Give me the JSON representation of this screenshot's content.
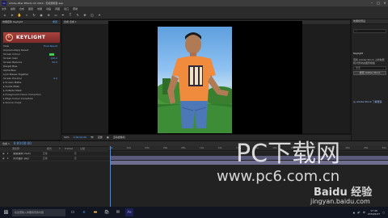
{
  "window": {
    "title": "Adobe After Effects CC 2019 - 无标题项目.aep",
    "app_icon_text": "Ae"
  },
  "menu": [
    "文件",
    "编辑",
    "合成",
    "图层",
    "效果",
    "动画",
    "视图",
    "窗口",
    "帮助"
  ],
  "effect_controls": {
    "tab_label": "效果控件 Keylight",
    "reset_label": "重置",
    "keylight_name": "KEYLIGHT",
    "rows": [
      {
        "label": "View",
        "value": "Final Result"
      },
      {
        "label": "Unpremultiply Result",
        "value": ""
      },
      {
        "label": "Screen Colour",
        "value": ""
      },
      {
        "label": "Screen Gain",
        "value": "100.0"
      },
      {
        "label": "Screen Balance",
        "value": "50.0"
      },
      {
        "label": "Despill Bias",
        "value": ""
      },
      {
        "label": "Alpha Bias",
        "value": ""
      },
      {
        "label": "Lock Biases Together",
        "value": ""
      },
      {
        "label": "Screen Pre-blur",
        "value": "0.0"
      },
      {
        "label": "Screen Matte",
        "value": ""
      },
      {
        "label": "Inside Mask",
        "value": ""
      },
      {
        "label": "Outside Mask",
        "value": ""
      },
      {
        "label": "Foreground Colour Correction",
        "value": ""
      },
      {
        "label": "Edge Colour Correction",
        "value": ""
      },
      {
        "label": "Source Crops",
        "value": ""
      }
    ],
    "screen_colour_hex": "#3bd24b"
  },
  "viewer": {
    "tab_label": "合成 合成 1",
    "zoom": "50%",
    "timecode": "0:00:00:00",
    "quality": "完整",
    "camera": "活动摄像机"
  },
  "right_panel": {
    "tab_label": "效果和预设",
    "section_label": "Keylight",
    "description": "查找 Adobe Stock 上的免费和付费动态图形模板",
    "search_placeholder": "搜索",
    "button_label": "搜索 Adobe Stock",
    "footer": "从 Adobe Stock 了解更多"
  },
  "timeline": {
    "tab_label": "合成 1",
    "current_time": "0:00:00:00",
    "columns": [
      "源名称",
      "模式",
      "T",
      "TrkMat",
      "父级"
    ],
    "layers": [
      {
        "num": "1",
        "name": "[视频素材.mp4]",
        "mode": "正常",
        "parent": "无"
      },
      {
        "num": "2",
        "name": "[背景图片.jpg]",
        "mode": "正常",
        "parent": "无"
      }
    ],
    "ruler_marks": [
      "0s",
      "02s",
      "04s",
      "06s",
      "08s",
      "10s",
      "12s",
      "14s",
      "16s",
      "18s",
      "20s",
      "22s",
      "24s",
      "26s",
      "28s",
      "30s"
    ]
  },
  "taskbar": {
    "search_placeholder": "在这里输入你要搜索的内容",
    "time": "17:46",
    "date": "2019/6/27",
    "lang": "中"
  },
  "watermarks": {
    "pc": "PC下载网",
    "pc_url": "www.pc6.com.cn",
    "baidu": "Baidu 经验",
    "baidu_url": "jingyan.baidu.com"
  },
  "colors": {
    "ae_blue": "#3a8dff",
    "keylight_red": "#a8433e"
  }
}
